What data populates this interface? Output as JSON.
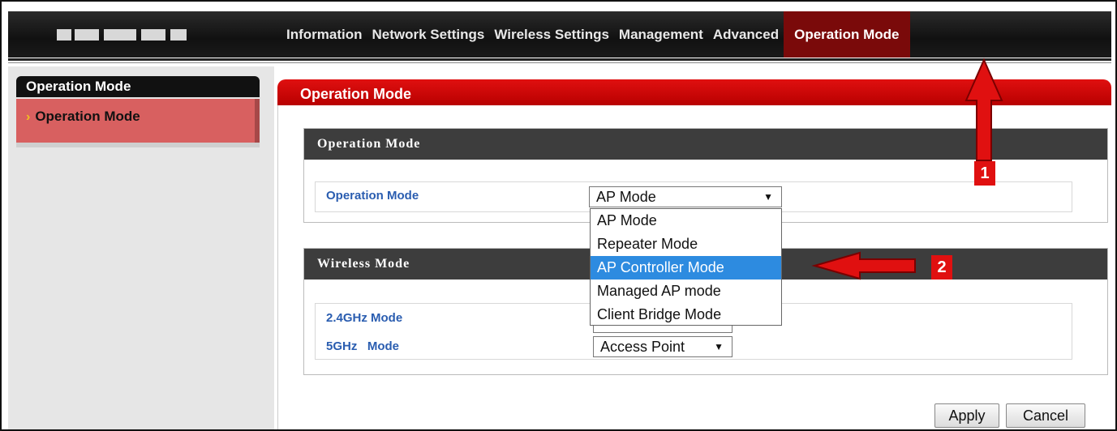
{
  "nav": {
    "items": [
      {
        "label": "Information"
      },
      {
        "label": "Network Settings"
      },
      {
        "label": "Wireless Settings"
      },
      {
        "label": "Management"
      },
      {
        "label": "Advanced"
      },
      {
        "label": "Operation Mode"
      }
    ],
    "active": "Operation Mode"
  },
  "sidebar": {
    "heading": "Operation Mode",
    "items": [
      {
        "label": "Operation Mode",
        "chevron": "›"
      }
    ]
  },
  "main": {
    "title": "Operation Mode",
    "operation_section": {
      "heading": "Operation Mode",
      "label": "Operation Mode",
      "selected": "AP Mode",
      "options": [
        "AP Mode",
        "Repeater Mode",
        "AP Controller Mode",
        "Managed AP mode",
        "Client Bridge Mode"
      ],
      "highlighted": "AP Controller Mode"
    },
    "wireless_section": {
      "heading": "Wireless Mode",
      "rows": [
        {
          "label": "2.4GHz Mode",
          "value": ""
        },
        {
          "label": "5GHz   Mode",
          "value": "Access Point"
        }
      ]
    },
    "buttons": {
      "apply": "Apply",
      "cancel": "Cancel"
    }
  },
  "annotations": {
    "badge1": "1",
    "badge2": "2",
    "accent_color": "#e01010"
  },
  "colors": {
    "nav_bg": "#111111",
    "nav_active": "#7a0a0a",
    "header_red": "#e01010",
    "section_head": "#3d3d3d",
    "label_blue": "#2a5db0",
    "highlight": "#2d8be0"
  }
}
